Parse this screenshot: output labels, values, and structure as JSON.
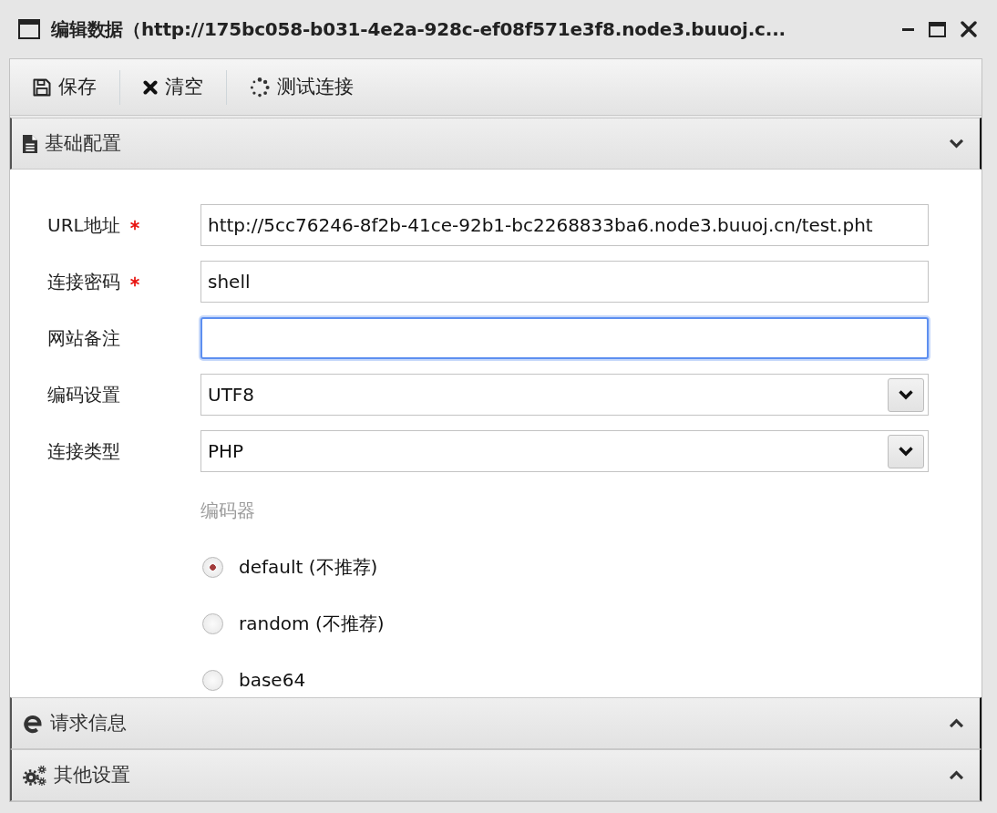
{
  "window": {
    "title": "编辑数据（http://175bc058-b031-4e2a-928c-ef08f571e3f8.node3.buuoj.c..."
  },
  "toolbar": [
    {
      "kind": "save",
      "label": "保存"
    },
    {
      "kind": "clear",
      "label": "清空"
    },
    {
      "kind": "test",
      "label": "测试连接"
    }
  ],
  "sections": [
    {
      "kind": "basic",
      "title": "基础配置",
      "expanded": true,
      "fields": [
        {
          "kind": "text",
          "label": "URL地址",
          "required": true,
          "focused": false,
          "value": "http://5cc76246-8f2b-41ce-92b1-bc2268833ba6.node3.buuoj.cn/test.pht"
        },
        {
          "kind": "text",
          "label": "连接密码",
          "required": true,
          "focused": false,
          "value": "shell"
        },
        {
          "kind": "text",
          "label": "网站备注",
          "required": false,
          "focused": true
        },
        {
          "kind": "select",
          "label": "编码设置",
          "required": false,
          "focused": false,
          "value": "UTF8"
        },
        {
          "kind": "select",
          "label": "连接类型",
          "required": false,
          "focused": false,
          "value": "PHP"
        }
      ],
      "encoder": {
        "label": "编码器",
        "options": [
          {
            "label": "default (不推荐)",
            "selected": true
          },
          {
            "label": "random (不推荐)",
            "selected": false
          },
          {
            "label": "base64",
            "selected": false
          }
        ]
      }
    },
    {
      "kind": "request",
      "title": "请求信息",
      "expanded": false
    },
    {
      "kind": "other",
      "title": "其他设置",
      "expanded": false
    }
  ]
}
